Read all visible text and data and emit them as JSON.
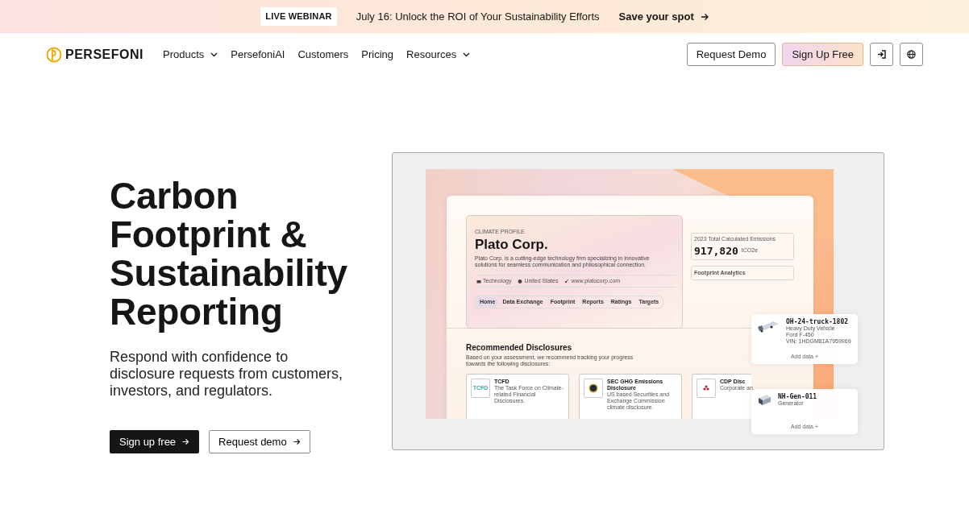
{
  "banner": {
    "badge": "LIVE WEBINAR",
    "text": "July 16: Unlock the ROI of Your Sustainability Efforts",
    "link": "Save your spot"
  },
  "nav": {
    "logo": "PERSEFONI",
    "items": [
      {
        "label": "Products",
        "dropdown": true
      },
      {
        "label": "PersefoniAI",
        "dropdown": false
      },
      {
        "label": "Customers",
        "dropdown": false
      },
      {
        "label": "Pricing",
        "dropdown": false
      },
      {
        "label": "Resources",
        "dropdown": true
      }
    ],
    "request_demo": "Request Demo",
    "sign_up": "Sign Up Free"
  },
  "hero": {
    "title": "Carbon Footprint  & Sustainability Reporting",
    "subtitle": "Respond with confidence to disclosure requests from customers, investors, and regulators.",
    "primary_button": "Sign up free",
    "secondary_button": "Request demo"
  },
  "mockup": {
    "profile": {
      "eyebrow": "CLIMATE PROFILE",
      "name": "Plato Corp.",
      "description": "Plato Corp. is a cutting-edge technology firm specializing in innovative solutions for seamless communication and philosophical connection.",
      "tags": [
        "Technology",
        "United States",
        "www.platocorp.com"
      ],
      "tabs": [
        {
          "label": "Home",
          "selected": true
        },
        {
          "label": "Data Exchange",
          "selected": false
        },
        {
          "label": "Footprint",
          "selected": false
        },
        {
          "label": "Reports",
          "selected": false
        },
        {
          "label": "Ratings",
          "selected": false
        },
        {
          "label": "Targets",
          "selected": false
        }
      ]
    },
    "emissions": {
      "label": "2023 Total Calculated Emissions",
      "value": "917,820",
      "unit": "tCO2e"
    },
    "analytics": "Footprint Analytics",
    "recommended": {
      "title": "Recommended Disclosures",
      "text": "Based on your assessment, we recommend tracking your progress towards the following disclosures:",
      "cards": [
        {
          "kind": "tcfd",
          "logo": "TCFD",
          "title": "TCFD",
          "description": "The Task Force on Climate-related Financial Disclosures."
        },
        {
          "kind": "seal",
          "title": "SEC GHG Emissions Disclosure",
          "description": "US based Securities and Exchange Commission climate disclosure."
        },
        {
          "kind": "cdp",
          "title": "CDP Disc",
          "description": "Corporate an"
        }
      ]
    },
    "assets": [
      {
        "kind": "truck",
        "name": "OH-24-truck-1802",
        "lines": [
          "Heavy Duty Vehicle",
          "Ford F-450",
          "VIN: 1HDGM81A7959969"
        ],
        "action": "Add data +"
      },
      {
        "kind": "generator",
        "name": "NH-Gen-011",
        "lines": [
          "Generator"
        ],
        "action": "Add data +"
      }
    ]
  }
}
